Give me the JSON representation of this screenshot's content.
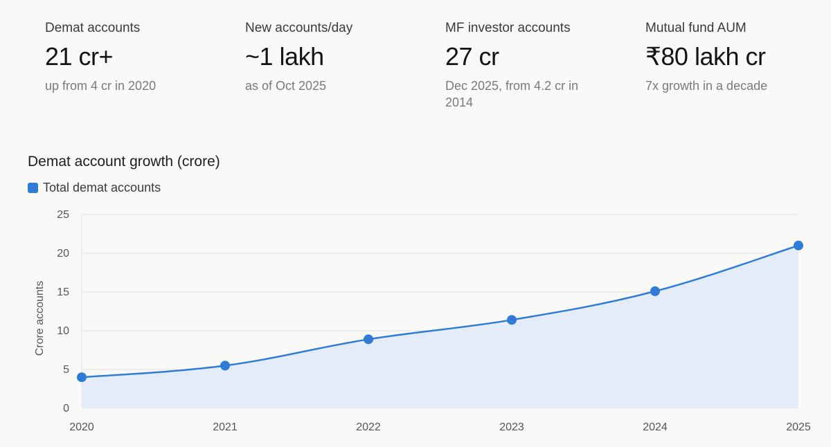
{
  "stats": [
    {
      "label": "Demat accounts",
      "value": "21 cr+",
      "sub": "up from 4 cr in 2020"
    },
    {
      "label": "New accounts/day",
      "value": "~1 lakh",
      "sub": "as of Oct 2025"
    },
    {
      "label": "MF investor accounts",
      "value": "27 cr",
      "sub": "Dec 2025, from 4.2 cr in 2014"
    },
    {
      "label": "Mutual fund AUM",
      "value": "₹80 lakh cr",
      "sub": "7x growth in a decade"
    }
  ],
  "chart_data": {
    "type": "area",
    "title": "Demat account growth (crore)",
    "x": [
      "2020",
      "2021",
      "2022",
      "2023",
      "2024",
      "2025"
    ],
    "series": [
      {
        "name": "Total demat accounts",
        "values": [
          4,
          5.5,
          8.9,
          11.4,
          15.1,
          21
        ]
      }
    ],
    "ylabel": "Crore accounts",
    "xlabel": "",
    "ylim": [
      0,
      25
    ],
    "yticks": [
      0,
      5,
      10,
      15,
      20,
      25
    ],
    "grid": true,
    "legend": "top-left",
    "colors": {
      "line": "#2f7bd6",
      "fill": "#e3ecf8",
      "grid": "#e2e2e2"
    }
  }
}
